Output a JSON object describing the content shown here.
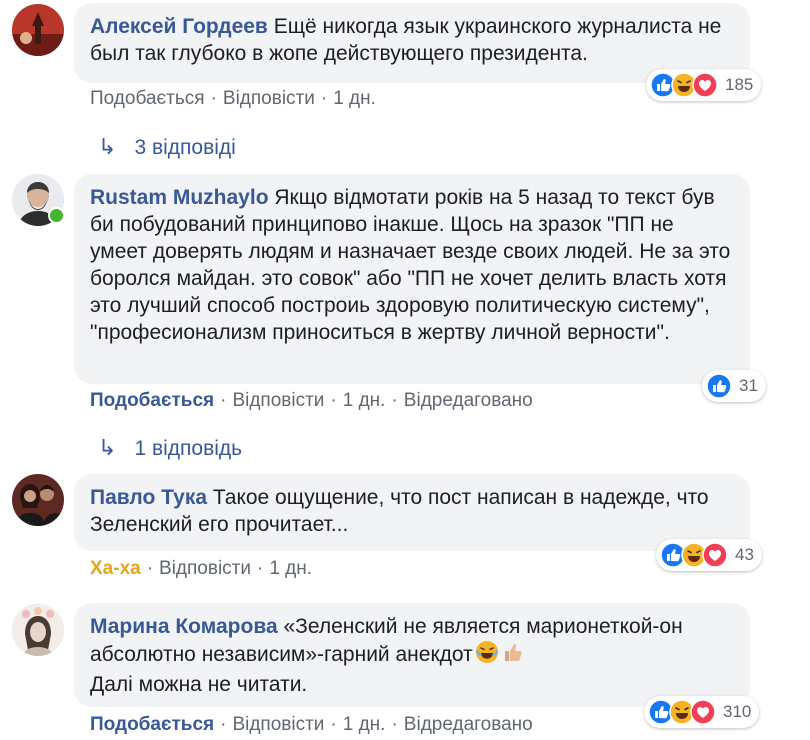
{
  "comments": [
    {
      "author": "Алексей Гордеев",
      "text": "Ещё никогда язык украинского журналиста не был так глубоко в жопе действующего президента.",
      "actions": {
        "like": "Подобається",
        "reply": "Відповісти",
        "time": "1 дн."
      },
      "reactions": {
        "icons": [
          "like-icon",
          "haha-icon",
          "love-icon"
        ],
        "count": "185"
      },
      "replies": "3 відповіді"
    },
    {
      "author": "Rustam Muzhaylo",
      "text": "Якщо відмотати років на 5 назад то текст був би побудований принципово інакше. Щось на зразок \"ПП не умеет доверять людям и назначает везде своих людей. Не за это боролся майдан. это совок\" або \"ПП не хочет делить власть хотя это лучший способ построиь здоровую политическую систему\", \"професионализм приноситься в жертву личной верности\".",
      "actions": {
        "like": "Подобається",
        "reply": "Відповісти",
        "time": "1 дн.",
        "edited": "Відредаговано"
      },
      "reactions": {
        "icons": [
          "like-icon"
        ],
        "count": "31"
      },
      "replies": "1 відповідь"
    },
    {
      "author": "Павло Тука",
      "text": "Такое ощущение, что пост написан в надежде, что Зеленский его прочитает...",
      "actions": {
        "like": "Ха-ха",
        "reply": "Відповісти",
        "time": "1 дн."
      },
      "reactions": {
        "icons": [
          "like-icon",
          "haha-icon",
          "love-icon"
        ],
        "count": "43"
      }
    },
    {
      "author": "Марина Комарова",
      "text": "«Зеленский не является марионеткой-он абсолютно независим»-гарний анекдот",
      "text2": "Далі можна не читати.",
      "inline_emoji": [
        "laughing-tears-icon",
        "thumbs-up-icon"
      ],
      "actions": {
        "like": "Подобається",
        "reply": "Відповісти",
        "time": "1 дн.",
        "edited": "Відредаговано"
      },
      "reactions": {
        "icons": [
          "like-icon",
          "haha-icon",
          "love-icon"
        ],
        "count": "310"
      }
    }
  ],
  "colors": {
    "author": "#385898",
    "like": "#1877f2",
    "haha": "#f7b125",
    "love": "#f33e58",
    "online": "#42b72a"
  }
}
